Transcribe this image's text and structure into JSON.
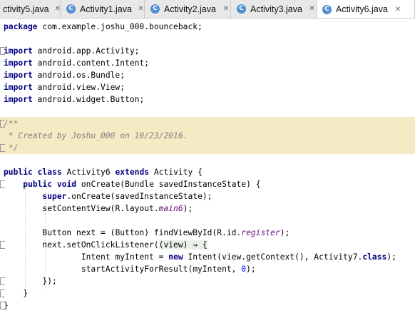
{
  "tabs": [
    {
      "label": "ctivity5.java",
      "active": false
    },
    {
      "label": "Activity1.java",
      "active": false
    },
    {
      "label": "Activity2.java",
      "active": false
    },
    {
      "label": "Activity3.java",
      "active": false
    },
    {
      "label": "Activity6.java",
      "active": true
    }
  ],
  "icons": {
    "class_file": "java-class-icon",
    "close": "close-icon"
  },
  "code": {
    "package_kw": "package",
    "package_name": " com.example.joshu_000.bounceback;",
    "imports": [
      " android.app.Activity;",
      " android.content.Intent;",
      " android.os.Bundle;",
      " android.view.View;",
      " android.widget.Button;"
    ],
    "import_kw": "import",
    "doc_open": "/**",
    "doc_text": " * Created by Joshu_000 on 10/23/2016.",
    "doc_close": " */",
    "l14_kw1": "public",
    "l14_kw2": "class",
    "l14_name": " Activity6 ",
    "l14_kw3": "extends",
    "l14_rest": " Activity {",
    "l15_kw1": "public",
    "l15_kw2": "void",
    "l15_rest": " onCreate(Bundle savedInstanceState) {",
    "l16_kw": "super",
    "l16_rest": ".onCreate(savedInstanceState);",
    "l17_a": "setContentView(R.layout.",
    "l17_it": "main6",
    "l17_b": ");",
    "l19_a": "Button next = (Button) findViewById(R.id.",
    "l19_it": "register",
    "l19_b": ");",
    "l20_a": "next.setOnClickListener(",
    "l20_lam": "(view) → {",
    "l21_a": "Intent myIntent = ",
    "l21_kw": "new",
    "l21_b": " Intent(view.getContext(), Activity7.",
    "l21_kw2": "class",
    "l21_c": ");",
    "l22_a": "startActivityForResult(myIntent, ",
    "l22_num": "0",
    "l22_b": ");",
    "l23": "});",
    "l24": "}",
    "l25": "}"
  }
}
